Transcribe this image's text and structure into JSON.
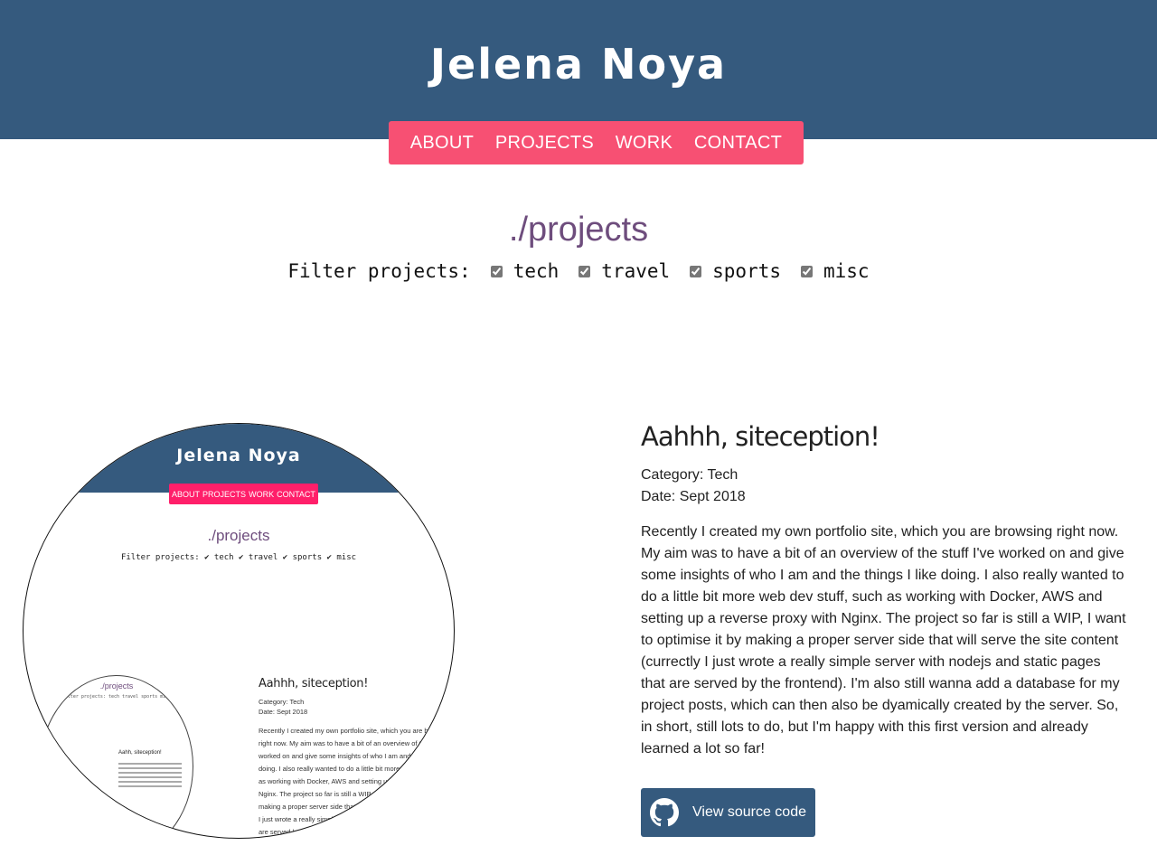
{
  "header": {
    "site_title": "Jelena Noya",
    "background_color": "#355a7e"
  },
  "nav": {
    "background_color": "#f75073",
    "items": [
      "ABOUT",
      "PROJECTS",
      "WORK",
      "CONTACT"
    ]
  },
  "page": {
    "heading": "./projects",
    "filter_label": "Filter projects:",
    "filters": [
      {
        "label": "tech",
        "checked": true
      },
      {
        "label": "travel",
        "checked": true
      },
      {
        "label": "sports",
        "checked": true
      },
      {
        "label": "misc",
        "checked": true
      }
    ]
  },
  "project": {
    "title": "Aahhh, siteception!",
    "category": "Category: Tech",
    "date": "Date: Sept 2018",
    "description": "Recently I created my own portfolio site, which you are browsing right now. My aim was to have a bit of an overview of the stuff I've worked on and give some insights of who I am and the things I like doing. I also really wanted to do a little bit more web dev stuff, such as working with Docker, AWS and setting up a reverse proxy with Nginx. The project so far is still a WIP, I want to optimise it by making a proper server side that will serve the site content (currectly I just wrote a really simple server with nodejs and static pages that are served by the frontend). I'm also still wanna add a database for my project posts, which can then also be dyamically created by the server. So, in short, still lots to do, but I'm happy with this first version and already learned a lot so far!",
    "source_button_label": "View source code",
    "source_icon": "github-icon"
  },
  "preview": {
    "site_title": "Jelena Noya",
    "nav_items": [
      "ABOUT",
      "PROJECTS",
      "WORK",
      "CONTACT"
    ],
    "heading": "./projects",
    "filter_text": "Filter projects:  ✔ tech  ✔ travel  ✔ sports  ✔ misc",
    "post_title": "Aahhh, siteception!",
    "category": "Category: Tech",
    "date": "Date: Sept 2018",
    "description": "Recently I created my own portfolio site, which you are browsing right now. My aim was to have a bit of an overview of the stuff I've worked on and give some insights of who I am and the things I like doing. I also really wanted to do a little bit more web dev stuff, such as working with Docker, AWS and setting up a reverse proxy with Nginx. The project so far is still a WIP, I want to optimise it by making a proper server side that will serve the site content (currectly I just wrote a really simple server with nodejs and static pages that are served by the frontend). I'm also still wanna add a database for my project posts, which can then also be dyamically created by the server.",
    "inner_heading": "./projects",
    "inner_filter": "Filter projects: tech travel sports misc",
    "inner_title": "Aahh, siteception!"
  }
}
